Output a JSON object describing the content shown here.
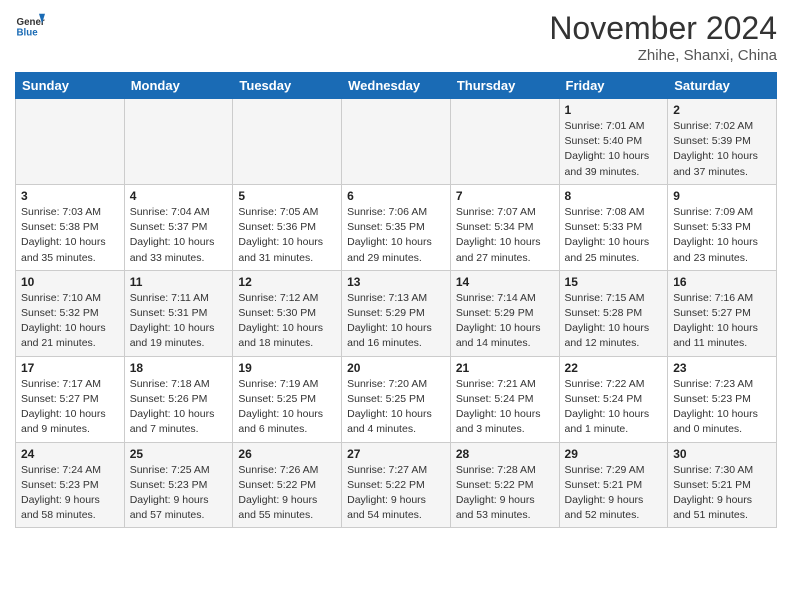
{
  "header": {
    "logo_line1": "General",
    "logo_line2": "Blue",
    "month_title": "November 2024",
    "location": "Zhihe, Shanxi, China"
  },
  "weekdays": [
    "Sunday",
    "Monday",
    "Tuesday",
    "Wednesday",
    "Thursday",
    "Friday",
    "Saturday"
  ],
  "weeks": [
    [
      {
        "day": "",
        "info": ""
      },
      {
        "day": "",
        "info": ""
      },
      {
        "day": "",
        "info": ""
      },
      {
        "day": "",
        "info": ""
      },
      {
        "day": "",
        "info": ""
      },
      {
        "day": "1",
        "info": "Sunrise: 7:01 AM\nSunset: 5:40 PM\nDaylight: 10 hours and 39 minutes."
      },
      {
        "day": "2",
        "info": "Sunrise: 7:02 AM\nSunset: 5:39 PM\nDaylight: 10 hours and 37 minutes."
      }
    ],
    [
      {
        "day": "3",
        "info": "Sunrise: 7:03 AM\nSunset: 5:38 PM\nDaylight: 10 hours and 35 minutes."
      },
      {
        "day": "4",
        "info": "Sunrise: 7:04 AM\nSunset: 5:37 PM\nDaylight: 10 hours and 33 minutes."
      },
      {
        "day": "5",
        "info": "Sunrise: 7:05 AM\nSunset: 5:36 PM\nDaylight: 10 hours and 31 minutes."
      },
      {
        "day": "6",
        "info": "Sunrise: 7:06 AM\nSunset: 5:35 PM\nDaylight: 10 hours and 29 minutes."
      },
      {
        "day": "7",
        "info": "Sunrise: 7:07 AM\nSunset: 5:34 PM\nDaylight: 10 hours and 27 minutes."
      },
      {
        "day": "8",
        "info": "Sunrise: 7:08 AM\nSunset: 5:33 PM\nDaylight: 10 hours and 25 minutes."
      },
      {
        "day": "9",
        "info": "Sunrise: 7:09 AM\nSunset: 5:33 PM\nDaylight: 10 hours and 23 minutes."
      }
    ],
    [
      {
        "day": "10",
        "info": "Sunrise: 7:10 AM\nSunset: 5:32 PM\nDaylight: 10 hours and 21 minutes."
      },
      {
        "day": "11",
        "info": "Sunrise: 7:11 AM\nSunset: 5:31 PM\nDaylight: 10 hours and 19 minutes."
      },
      {
        "day": "12",
        "info": "Sunrise: 7:12 AM\nSunset: 5:30 PM\nDaylight: 10 hours and 18 minutes."
      },
      {
        "day": "13",
        "info": "Sunrise: 7:13 AM\nSunset: 5:29 PM\nDaylight: 10 hours and 16 minutes."
      },
      {
        "day": "14",
        "info": "Sunrise: 7:14 AM\nSunset: 5:29 PM\nDaylight: 10 hours and 14 minutes."
      },
      {
        "day": "15",
        "info": "Sunrise: 7:15 AM\nSunset: 5:28 PM\nDaylight: 10 hours and 12 minutes."
      },
      {
        "day": "16",
        "info": "Sunrise: 7:16 AM\nSunset: 5:27 PM\nDaylight: 10 hours and 11 minutes."
      }
    ],
    [
      {
        "day": "17",
        "info": "Sunrise: 7:17 AM\nSunset: 5:27 PM\nDaylight: 10 hours and 9 minutes."
      },
      {
        "day": "18",
        "info": "Sunrise: 7:18 AM\nSunset: 5:26 PM\nDaylight: 10 hours and 7 minutes."
      },
      {
        "day": "19",
        "info": "Sunrise: 7:19 AM\nSunset: 5:25 PM\nDaylight: 10 hours and 6 minutes."
      },
      {
        "day": "20",
        "info": "Sunrise: 7:20 AM\nSunset: 5:25 PM\nDaylight: 10 hours and 4 minutes."
      },
      {
        "day": "21",
        "info": "Sunrise: 7:21 AM\nSunset: 5:24 PM\nDaylight: 10 hours and 3 minutes."
      },
      {
        "day": "22",
        "info": "Sunrise: 7:22 AM\nSunset: 5:24 PM\nDaylight: 10 hours and 1 minute."
      },
      {
        "day": "23",
        "info": "Sunrise: 7:23 AM\nSunset: 5:23 PM\nDaylight: 10 hours and 0 minutes."
      }
    ],
    [
      {
        "day": "24",
        "info": "Sunrise: 7:24 AM\nSunset: 5:23 PM\nDaylight: 9 hours and 58 minutes."
      },
      {
        "day": "25",
        "info": "Sunrise: 7:25 AM\nSunset: 5:23 PM\nDaylight: 9 hours and 57 minutes."
      },
      {
        "day": "26",
        "info": "Sunrise: 7:26 AM\nSunset: 5:22 PM\nDaylight: 9 hours and 55 minutes."
      },
      {
        "day": "27",
        "info": "Sunrise: 7:27 AM\nSunset: 5:22 PM\nDaylight: 9 hours and 54 minutes."
      },
      {
        "day": "28",
        "info": "Sunrise: 7:28 AM\nSunset: 5:22 PM\nDaylight: 9 hours and 53 minutes."
      },
      {
        "day": "29",
        "info": "Sunrise: 7:29 AM\nSunset: 5:21 PM\nDaylight: 9 hours and 52 minutes."
      },
      {
        "day": "30",
        "info": "Sunrise: 7:30 AM\nSunset: 5:21 PM\nDaylight: 9 hours and 51 minutes."
      }
    ]
  ]
}
